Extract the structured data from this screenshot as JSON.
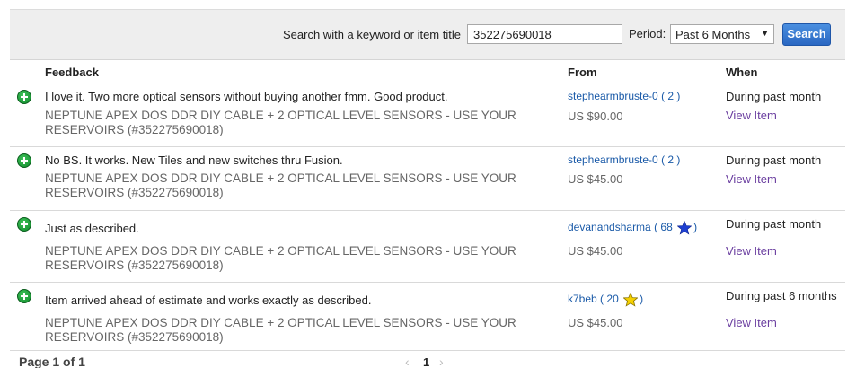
{
  "search": {
    "label": "Search with a keyword or item title",
    "value": "352275690018",
    "period_label": "Period:",
    "period_value": "Past 6 Months",
    "button_label": "Search"
  },
  "columns": {
    "feedback": "Feedback",
    "from": "From",
    "when": "When"
  },
  "rows": [
    {
      "comment": "I love it. Two more optical sensors without buying another fmm. Good product.",
      "item_title": "NEPTUNE APEX DOS DDR DIY CABLE + 2 OPTICAL LEVEL SENSORS - USE YOUR RESERVOIRS (#352275690018)",
      "user": "stephearmbruste-0",
      "score": "2",
      "star": "",
      "price": "US $90.00",
      "when": "During past month",
      "view_item": "View Item"
    },
    {
      "comment": "No BS. It works. New Tiles and new switches thru Fusion.",
      "item_title": "NEPTUNE APEX DOS DDR DIY CABLE + 2 OPTICAL LEVEL SENSORS - USE YOUR RESERVOIRS (#352275690018)",
      "user": "stephearmbruste-0",
      "score": "2",
      "star": "",
      "price": "US $45.00",
      "when": "During past month",
      "view_item": "View Item"
    },
    {
      "comment": "Just as described.",
      "item_title": "NEPTUNE APEX DOS DDR DIY CABLE + 2 OPTICAL LEVEL SENSORS - USE YOUR RESERVOIRS (#352275690018)",
      "user": "devanandsharma",
      "score": "68",
      "star": "blue",
      "price": "US $45.00",
      "when": "During past month",
      "view_item": "View Item"
    },
    {
      "comment": "Item arrived ahead of estimate and works exactly as described.",
      "item_title": "NEPTUNE APEX DOS DDR DIY CABLE + 2 OPTICAL LEVEL SENSORS - USE YOUR RESERVOIRS (#352275690018)",
      "user": "k7beb",
      "score": "20",
      "star": "yellow",
      "price": "US $45.00",
      "when": "During past 6 months",
      "view_item": "View Item"
    }
  ],
  "pager": {
    "label": "Page 1 of 1",
    "current": "1",
    "prev_icon": "chevron-left-icon",
    "next_icon": "chevron-right-icon"
  },
  "colors": {
    "link": "#1a5aa8",
    "visited_link": "#6b3fa0",
    "positive": "#108a2b",
    "button": "#2a67c2",
    "star_blue": "#1e3fd0",
    "star_yellow": "#f5d000"
  }
}
